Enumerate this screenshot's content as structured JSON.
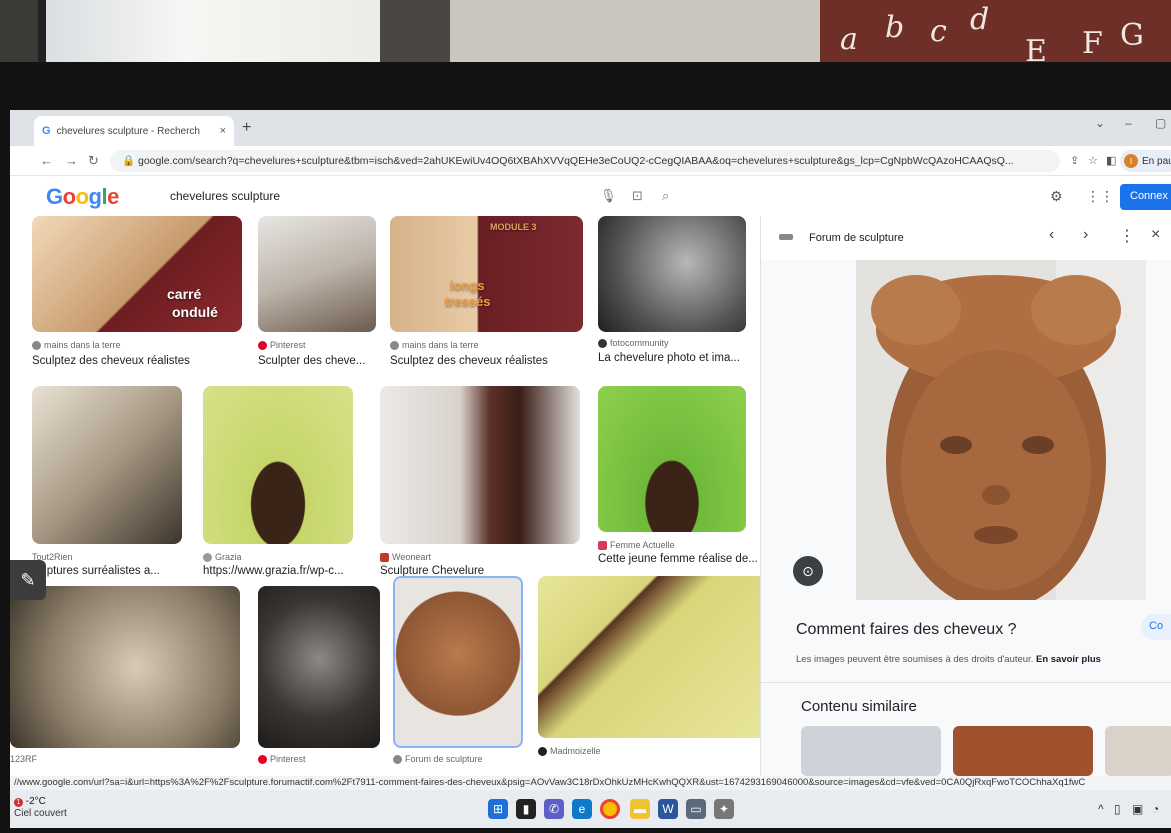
{
  "browser": {
    "tab_title": "chevelures sculpture - Recherch",
    "tab_close": "×",
    "new_tab": "+",
    "url": "google.com/search?q=chevelures+sculpture&tbm=isch&ved=2ahUKEwiUv4OQ6tXBAhXVVqQEHe3eCoUQ2-cCegQIABAA&oq=chevelures+sculpture&gs_lcp=CgNpbWcQAzoHCAAQsQ...",
    "profile_label": "En paus",
    "profile_initial": "I"
  },
  "google": {
    "logo": [
      "G",
      "o",
      "o",
      "g",
      "l",
      "e"
    ],
    "query": "chevelures sculpture",
    "connect_label": "Connex"
  },
  "results": [
    {
      "source": "mains dans la terre",
      "title": "Sculptez des cheveux réalistes",
      "overlay": [
        "carré",
        "ondulé"
      ]
    },
    {
      "source": "Pinterest",
      "title": "Sculpter des cheve..."
    },
    {
      "source": "mains dans la terre",
      "title": "Sculptez des cheveux réalistes",
      "overlay": [
        "MODULE 3",
        "longs",
        "tressés"
      ]
    },
    {
      "source": "fotocommunity",
      "title": "La chevelure photo et ima..."
    },
    {
      "source": "Tout2Rien",
      "title": "culptures surréalistes a..."
    },
    {
      "source": "Grazia",
      "title": "https://www.grazia.fr/wp-c..."
    },
    {
      "source": "Weoneart",
      "title": "Sculpture Chevelure"
    },
    {
      "source": "Femme Actuelle",
      "title": "Cette jeune femme réalise de..."
    },
    {
      "source": "123RF",
      "title": ""
    },
    {
      "source": "Pinterest",
      "title": ""
    },
    {
      "source": "Forum de sculpture",
      "title": ""
    },
    {
      "source": "Madmoizelle",
      "title": ""
    }
  ],
  "panel": {
    "site": "Forum de sculpture",
    "title": "Comment faires des cheveux ?",
    "visit": "Co",
    "rights_text": "Les images peuvent être soumises à des droits d'auteur.",
    "rights_link": "En savoir plus",
    "similar_heading": "Contenu similaire"
  },
  "status_url": "//www.google.com/url?sa=i&url=https%3A%2F%2Fsculpture.forumactif.com%2Ft7911-comment-faires-des-cheveux&psig=AOvVaw3C18rDxOhkUzMHcKwhQQXR&ust=1674293169046000&source=images&cd=vfe&ved=0CA0QjRxqFwoTCOChhaXq1fwC",
  "taskbar": {
    "temperature": "-2°C",
    "weather": "Ciel couvert",
    "alert": "1"
  },
  "colors": {
    "google_blue": "#1a73e8",
    "taskbar": "#e8ebf0"
  }
}
